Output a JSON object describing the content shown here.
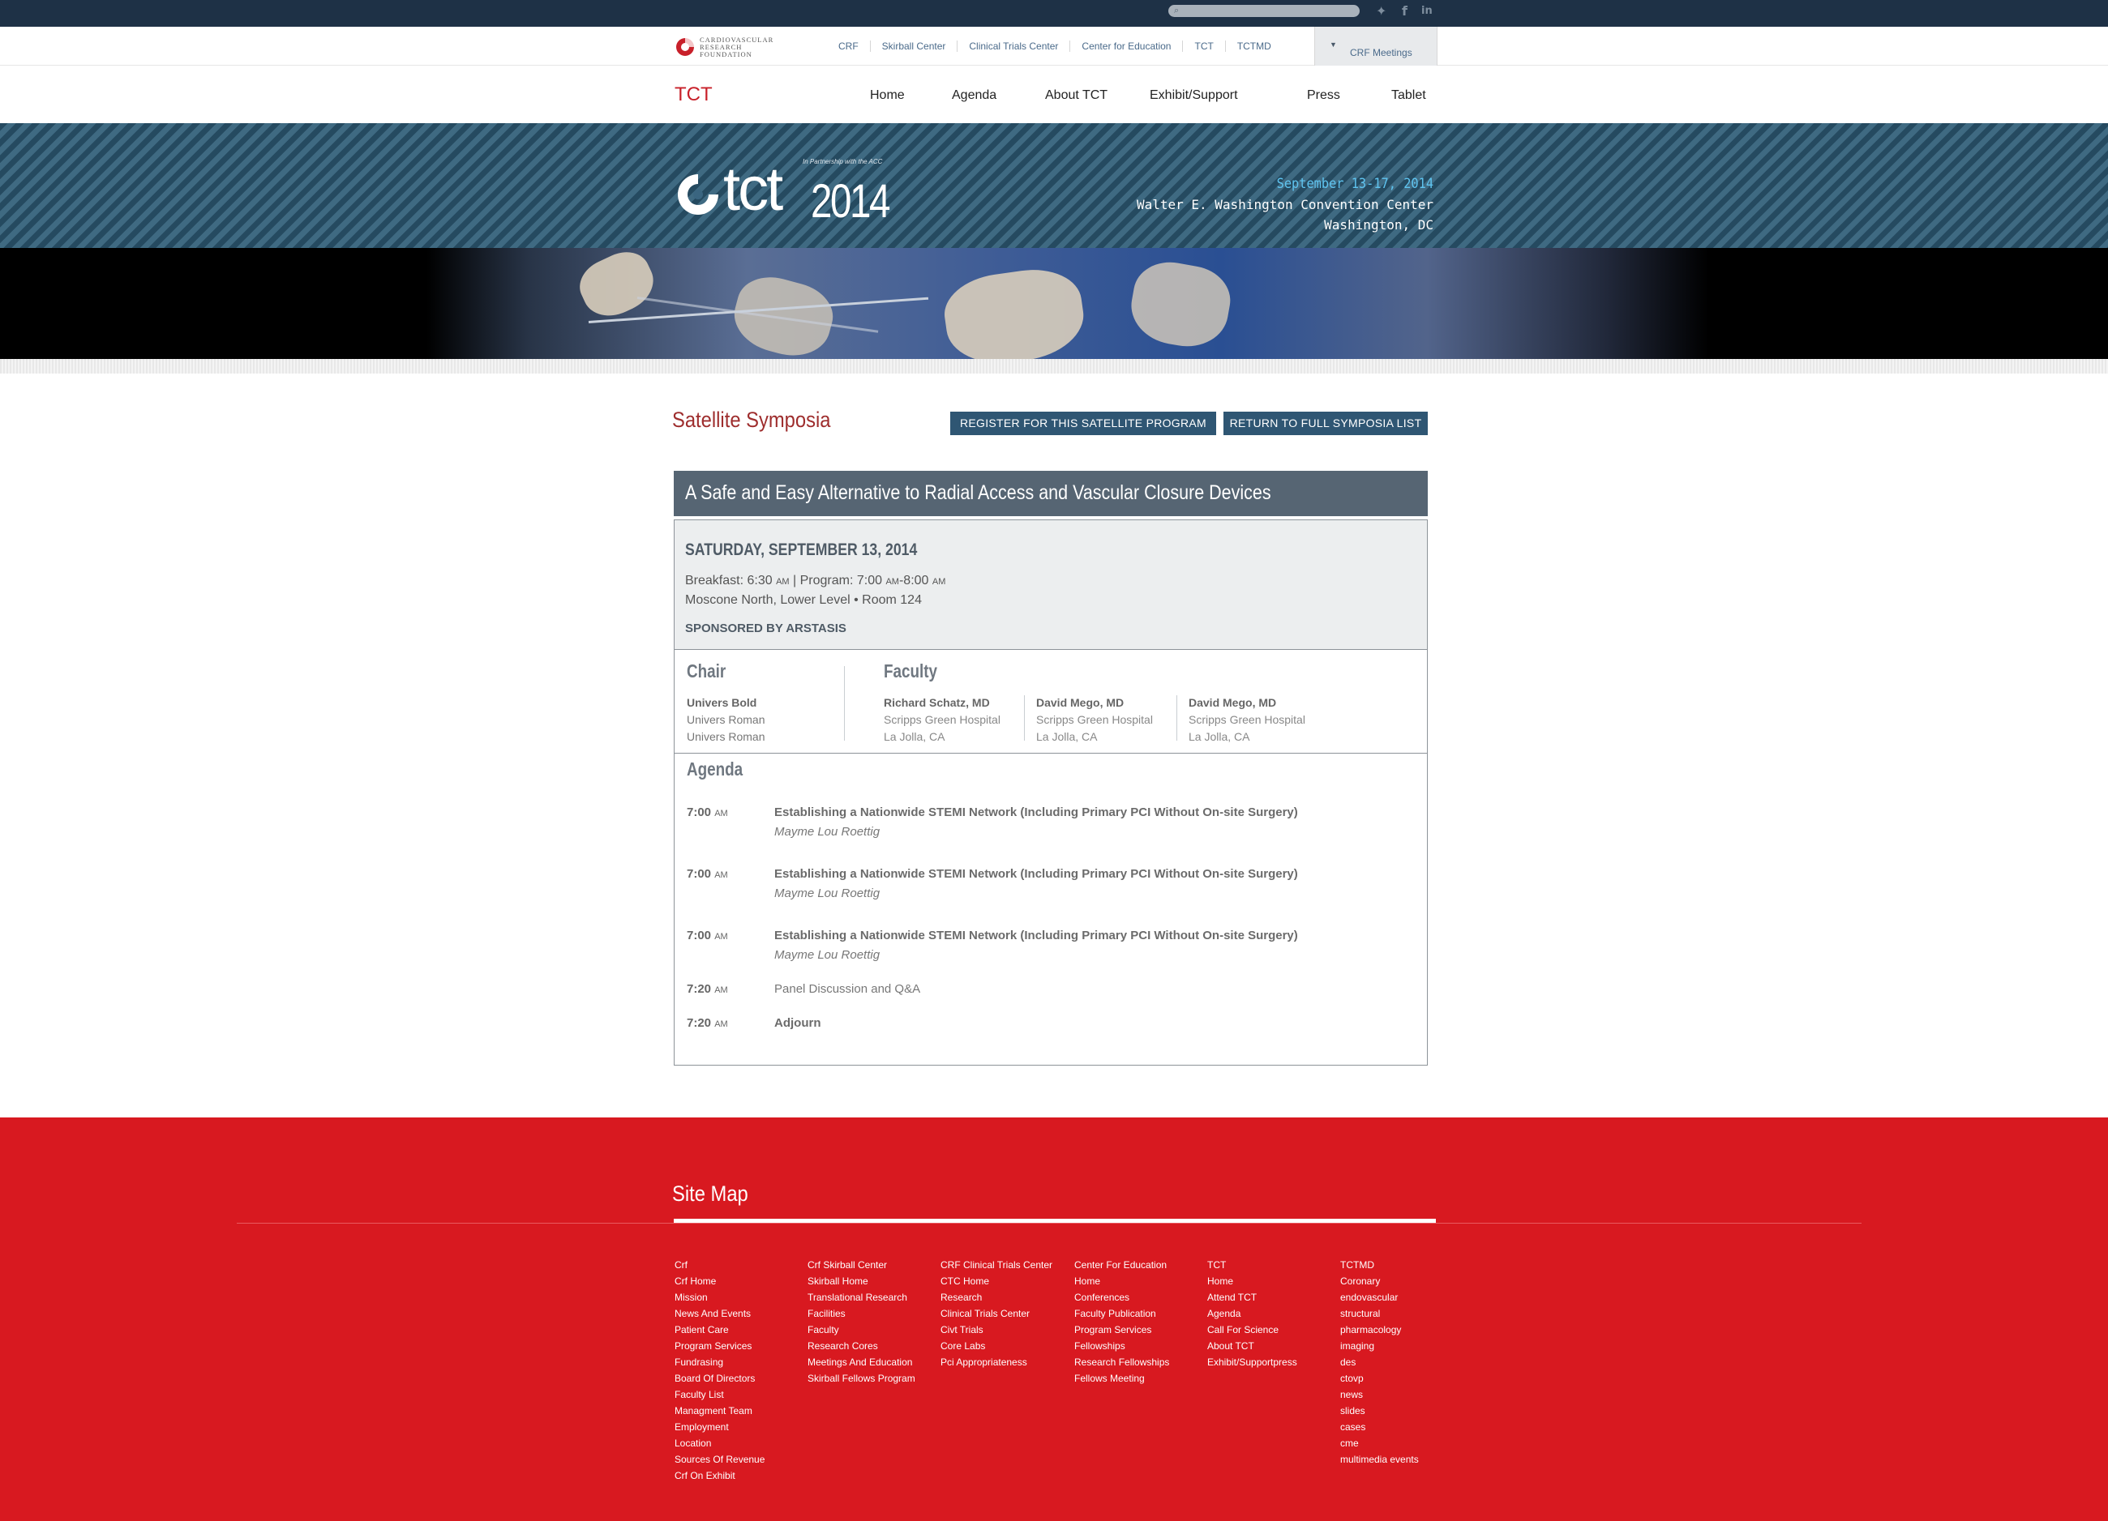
{
  "topbar": {
    "search_placeholder": "",
    "social": [
      {
        "icon": "twitter-icon",
        "glyph": "✦"
      },
      {
        "icon": "facebook-icon",
        "glyph": "f"
      },
      {
        "icon": "linkedin-icon",
        "glyph": "in"
      }
    ]
  },
  "org": {
    "logo_lines": [
      "CARDIOVASCULAR",
      "RESEARCH",
      "FOUNDATION"
    ],
    "links": [
      "CRF",
      "Skirball Center",
      "Clinical Trials Center",
      "Center for Education",
      "TCT",
      "TCTMD"
    ],
    "meetings_label": "CRF Meetings"
  },
  "nav": {
    "brand": "TCT",
    "items": [
      "Home",
      "Agenda",
      "About TCT",
      "Exhibit/Support",
      "Press",
      "Tablet"
    ]
  },
  "hero": {
    "logo_word": "tct",
    "logo_year": "2014",
    "partner": "In Partnership with the ACC",
    "dates": "September 13-17, 2014",
    "venue": "Walter E. Washington Convention Center",
    "city": "Washington, DC"
  },
  "page": {
    "section_title": "Satellite Symposia",
    "register_btn": "REGISTER FOR THIS SATELLITE PROGRAM",
    "return_btn": "RETURN TO FULL SYMPOSIA LIST",
    "program_title": "A Safe and Easy Alternative to Radial Access and Vascular Closure Devices",
    "date": "SATURDAY, SEPTEMBER 13, 2014",
    "breakfast_label": "Breakfast: 6:30",
    "program_label": "| Program: 7:00",
    "program_end": "-8:00",
    "am": "AM",
    "location": "Moscone North, Lower Level  •  Room 124",
    "sponsor": "SPONSORED BY ARSTASIS"
  },
  "chair": {
    "heading": "Chair",
    "names": [
      "Univers Bold",
      "Univers Roman",
      "Univers Roman"
    ]
  },
  "faculty": {
    "heading": "Faculty",
    "people": [
      {
        "name": "Richard Schatz, MD",
        "org": "Scripps Green Hospital",
        "loc": "La Jolla, CA"
      },
      {
        "name": "David Mego, MD",
        "org": "Scripps Green Hospital",
        "loc": "La Jolla, CA"
      },
      {
        "name": "David Mego, MD",
        "org": "Scripps Green Hospital",
        "loc": "La Jolla, CA"
      }
    ]
  },
  "agenda": {
    "heading": "Agenda",
    "items": [
      {
        "time": "7:00",
        "ampm": "AM",
        "title": "Establishing a Nationwide STEMI Network (Including Primary PCI Without On-site Surgery)",
        "speaker": "Mayme Lou Roettig"
      },
      {
        "time": "7:00",
        "ampm": "AM",
        "title": "Establishing a Nationwide STEMI Network (Including Primary PCI Without On-site Surgery)",
        "speaker": "Mayme Lou Roettig"
      },
      {
        "time": "7:00",
        "ampm": "AM",
        "title": "Establishing a Nationwide STEMI Network (Including Primary PCI Without On-site Surgery)",
        "speaker": "Mayme Lou Roettig"
      },
      {
        "time": "7:20",
        "ampm": "AM",
        "title": "Panel Discussion and Q&A",
        "speaker": ""
      },
      {
        "time": "7:20",
        "ampm": "AM",
        "title": "Adjourn",
        "speaker": ""
      }
    ]
  },
  "footer": {
    "title": "Site Map",
    "columns": [
      [
        "Crf",
        "Crf Home",
        "Mission",
        "News And Events",
        "Patient Care",
        "Program Services",
        "Fundrasing",
        "Board Of Directors",
        "Faculty List",
        "Managment Team",
        "Employment",
        "Location",
        "Sources Of Revenue",
        "Crf On Exhibit"
      ],
      [
        "Crf Skirball Center",
        "Skirball Home",
        "Translational Research",
        "Facilities",
        "Faculty",
        "Research Cores",
        "Meetings And Education",
        "Skirball Fellows Program"
      ],
      [
        "CRF Clinical Trials Center",
        "CTC Home",
        "Research",
        "Clinical Trials Center",
        "Civt Trials",
        "Core Labs",
        "Pci Appropriateness"
      ],
      [
        "Center For Education",
        "Home",
        "Conferences",
        "Faculty Publication",
        "Program Services",
        "Fellowships",
        "Research Fellowships",
        "Fellows Meeting"
      ],
      [
        "TCT",
        "Home",
        "Attend TCT",
        "Agenda",
        "Call For Science",
        "About TCT",
        "Exhibit/Supportpress"
      ],
      [
        "TCTMD",
        "Coronary",
        "endovascular",
        "structural",
        "pharmacology",
        "imaging",
        "des",
        "ctovp",
        "news",
        "slides",
        "cases",
        "cme",
        "multimedia events"
      ]
    ]
  },
  "colors": {
    "topbar": "#1e3146",
    "brand_red": "#c8202a",
    "button_blue": "#2f5673",
    "title_bar": "#566573",
    "footer_red": "#d81920"
  }
}
